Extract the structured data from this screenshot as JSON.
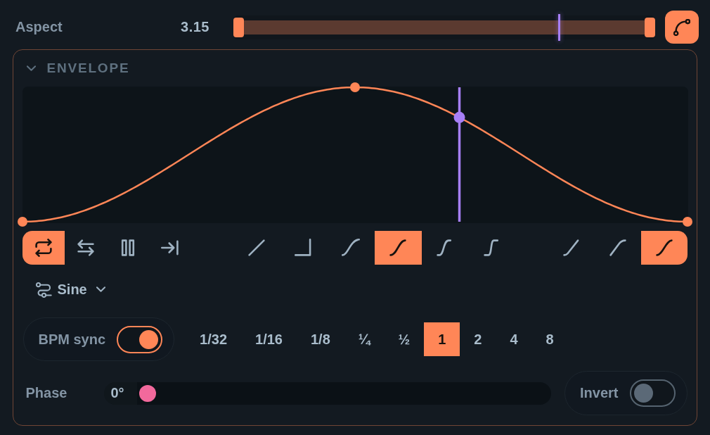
{
  "aspect": {
    "label": "Aspect",
    "value": "3.15",
    "range_start": {
      "level": 0
    },
    "range_end": {
      "level": 1
    },
    "playhead": {
      "level": 0.773
    },
    "curve_mode": {
      "on": true
    }
  },
  "envelope": {
    "title": "ENVELOPE",
    "expanded": true,
    "playhead": {
      "level": 0.657
    },
    "playback_modes": [
      {
        "kind": "loop",
        "selected": true
      },
      {
        "kind": "pingpong",
        "selected": false
      },
      {
        "kind": "pause",
        "selected": false
      },
      {
        "kind": "oneshot",
        "selected": false
      }
    ],
    "shapes": [
      {
        "kind": "linear",
        "selected": false
      },
      {
        "kind": "step",
        "selected": false
      },
      {
        "kind": "soft",
        "selected": false
      },
      {
        "kind": "smooth",
        "selected": true
      },
      {
        "kind": "steep",
        "selected": false
      },
      {
        "kind": "sharp",
        "selected": false
      }
    ],
    "easings": [
      {
        "kind": "in",
        "selected": false
      },
      {
        "kind": "out",
        "selected": false
      },
      {
        "kind": "inout",
        "selected": true
      }
    ],
    "waveform": {
      "value": "Sine"
    },
    "bpm_sync": {
      "label": "BPM sync",
      "on": true
    },
    "rates": [
      {
        "label": "1/32",
        "selected": false
      },
      {
        "label": "1/16",
        "selected": false
      },
      {
        "label": "1/8",
        "selected": false
      },
      {
        "label": "¼",
        "selected": false
      },
      {
        "label": "½",
        "selected": false
      },
      {
        "label": "1",
        "selected": true
      },
      {
        "label": "2",
        "selected": false
      },
      {
        "label": "4",
        "selected": false
      },
      {
        "label": "8",
        "selected": false
      }
    ],
    "phase": {
      "label": "Phase",
      "value": "0°",
      "level": 0
    },
    "invert": {
      "label": "Invert",
      "on": false
    }
  }
}
